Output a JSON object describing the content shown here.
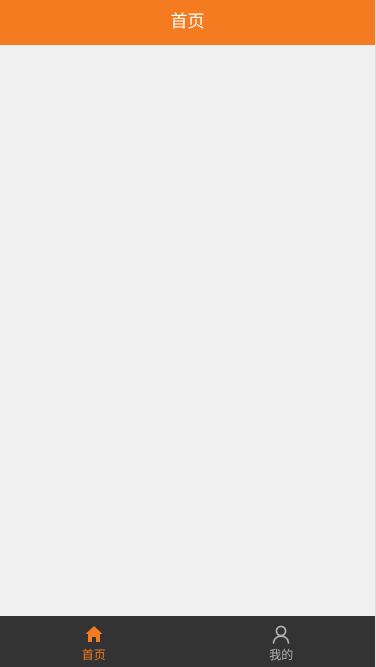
{
  "header": {
    "title": "首页"
  },
  "tabbar": {
    "tabs": [
      {
        "label": "首页",
        "icon": "home-icon",
        "active": true
      },
      {
        "label": "我的",
        "icon": "user-icon",
        "active": false
      }
    ]
  },
  "colors": {
    "accent": "#f57b20",
    "background": "#f0f0f0",
    "tabbar": "#333333",
    "inactive": "#b3b3b3"
  }
}
